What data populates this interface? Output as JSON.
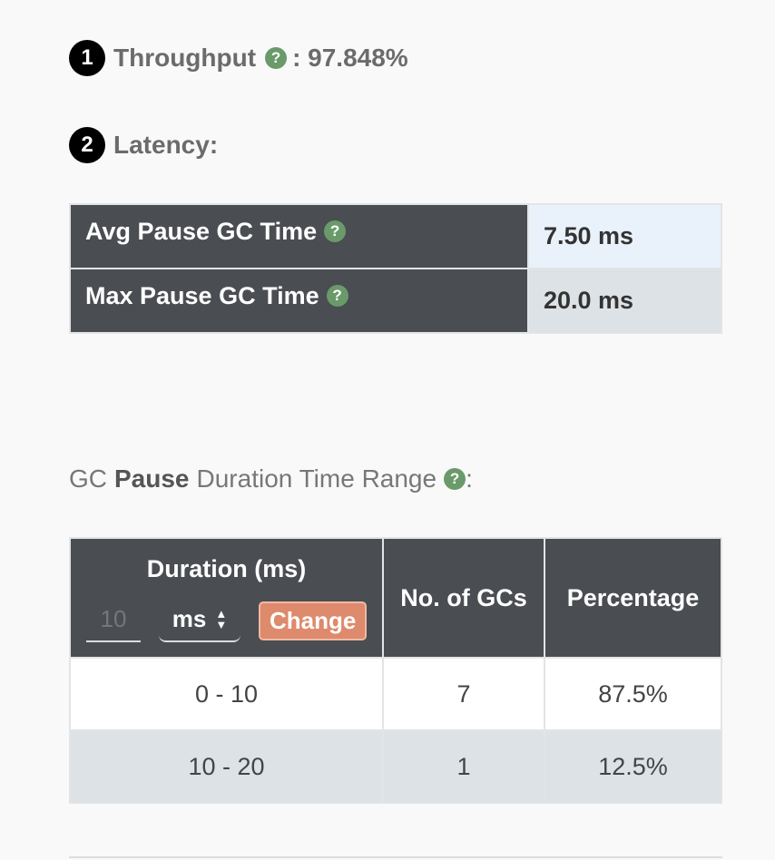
{
  "throughput": {
    "badge": "1",
    "label": "Throughput",
    "value": ": 97.848%"
  },
  "latency": {
    "badge": "2",
    "label": "Latency:"
  },
  "latency_table": [
    {
      "label": "Avg Pause GC Time",
      "value": "7.50 ms"
    },
    {
      "label": "Max Pause GC Time",
      "value": "20.0 ms"
    }
  ],
  "range_title": {
    "prefix": "GC",
    "bold": "Pause",
    "suffix": "Duration Time Range",
    "colon": ":"
  },
  "range_table": {
    "headers": {
      "duration": "Duration (ms)",
      "count": "No. of GCs",
      "percentage": "Percentage"
    },
    "controls": {
      "input_placeholder": "10",
      "unit": "ms",
      "change_label": "Change"
    },
    "rows": [
      {
        "range": "0 - 10",
        "count": "7",
        "percentage": "87.5%"
      },
      {
        "range": "10 - 20",
        "count": "1",
        "percentage": "12.5%"
      }
    ]
  },
  "icons": {
    "help": "question-circle-icon",
    "sort": "sort-arrows-icon"
  },
  "colors": {
    "header_bg": "#4a4d52",
    "help_icon": "#6a9a6a",
    "change_button": "#de8a6c"
  }
}
